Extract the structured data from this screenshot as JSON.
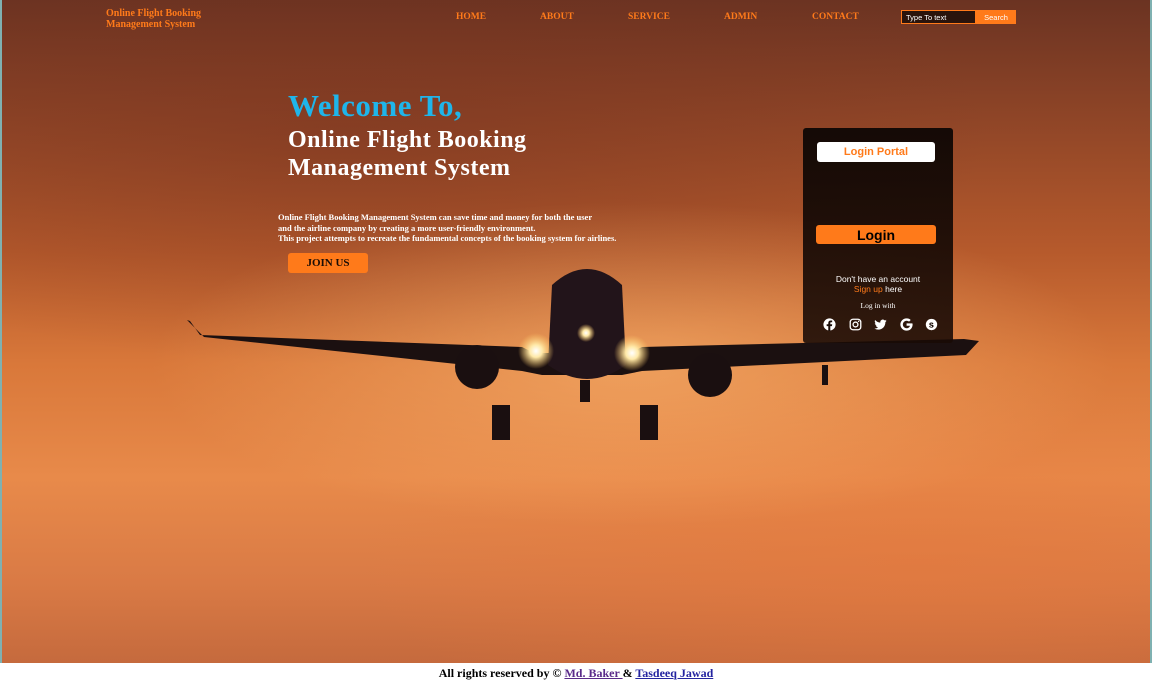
{
  "brand": {
    "line1": "Online Flight Booking",
    "line2": "Management System"
  },
  "nav": {
    "home": "HOME",
    "about": "ABOUT",
    "service": "SERVICE",
    "admin": "ADMIN",
    "contact": "CONTACT"
  },
  "search": {
    "placeholder": "Type To text",
    "button": "Search"
  },
  "hero": {
    "welcome": "Welcome To,",
    "title_line1": "Online Flight Booking",
    "title_line2": "Management System",
    "desc_line1": "Online Flight Booking Management System can save time and money for both the user",
    "desc_line2": "and the airline company by creating a more user-friendly environment.",
    "desc_line3": "This project attempts to recreate the fundamental concepts of the booking system for airlines.",
    "join_label": "JOIN US"
  },
  "login": {
    "title": "Login Portal",
    "button": "Login",
    "no_account": "Don't have an account",
    "signup_link": "Sign up",
    "signup_suffix": " here",
    "login_with": "Log in with",
    "socials": [
      "facebook-icon",
      "instagram-icon",
      "twitter-icon",
      "google-icon",
      "skype-icon"
    ]
  },
  "footer": {
    "prefix": "All rights reserved by © ",
    "author1": "Md. Baker ",
    "amp": "& ",
    "author2": "Tasdeeq Jawad"
  },
  "colors": {
    "accent": "#ff7a1a",
    "welcome": "#1fb5ea"
  }
}
